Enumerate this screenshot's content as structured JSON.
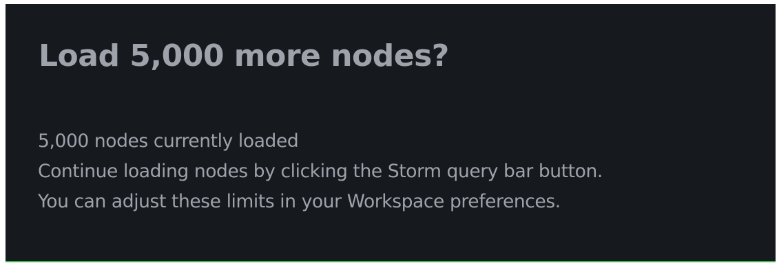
{
  "dialog": {
    "title": "Load 5,000 more nodes?",
    "status_line": "5,000 nodes currently loaded",
    "instruction_line": "Continue loading nodes by clicking the Storm query bar button.",
    "preferences_line": "You can adjust these limits in your Workspace preferences."
  },
  "colors": {
    "panel_background": "#16191e",
    "text": "#9ea3ab",
    "accent": "#3fb950"
  }
}
